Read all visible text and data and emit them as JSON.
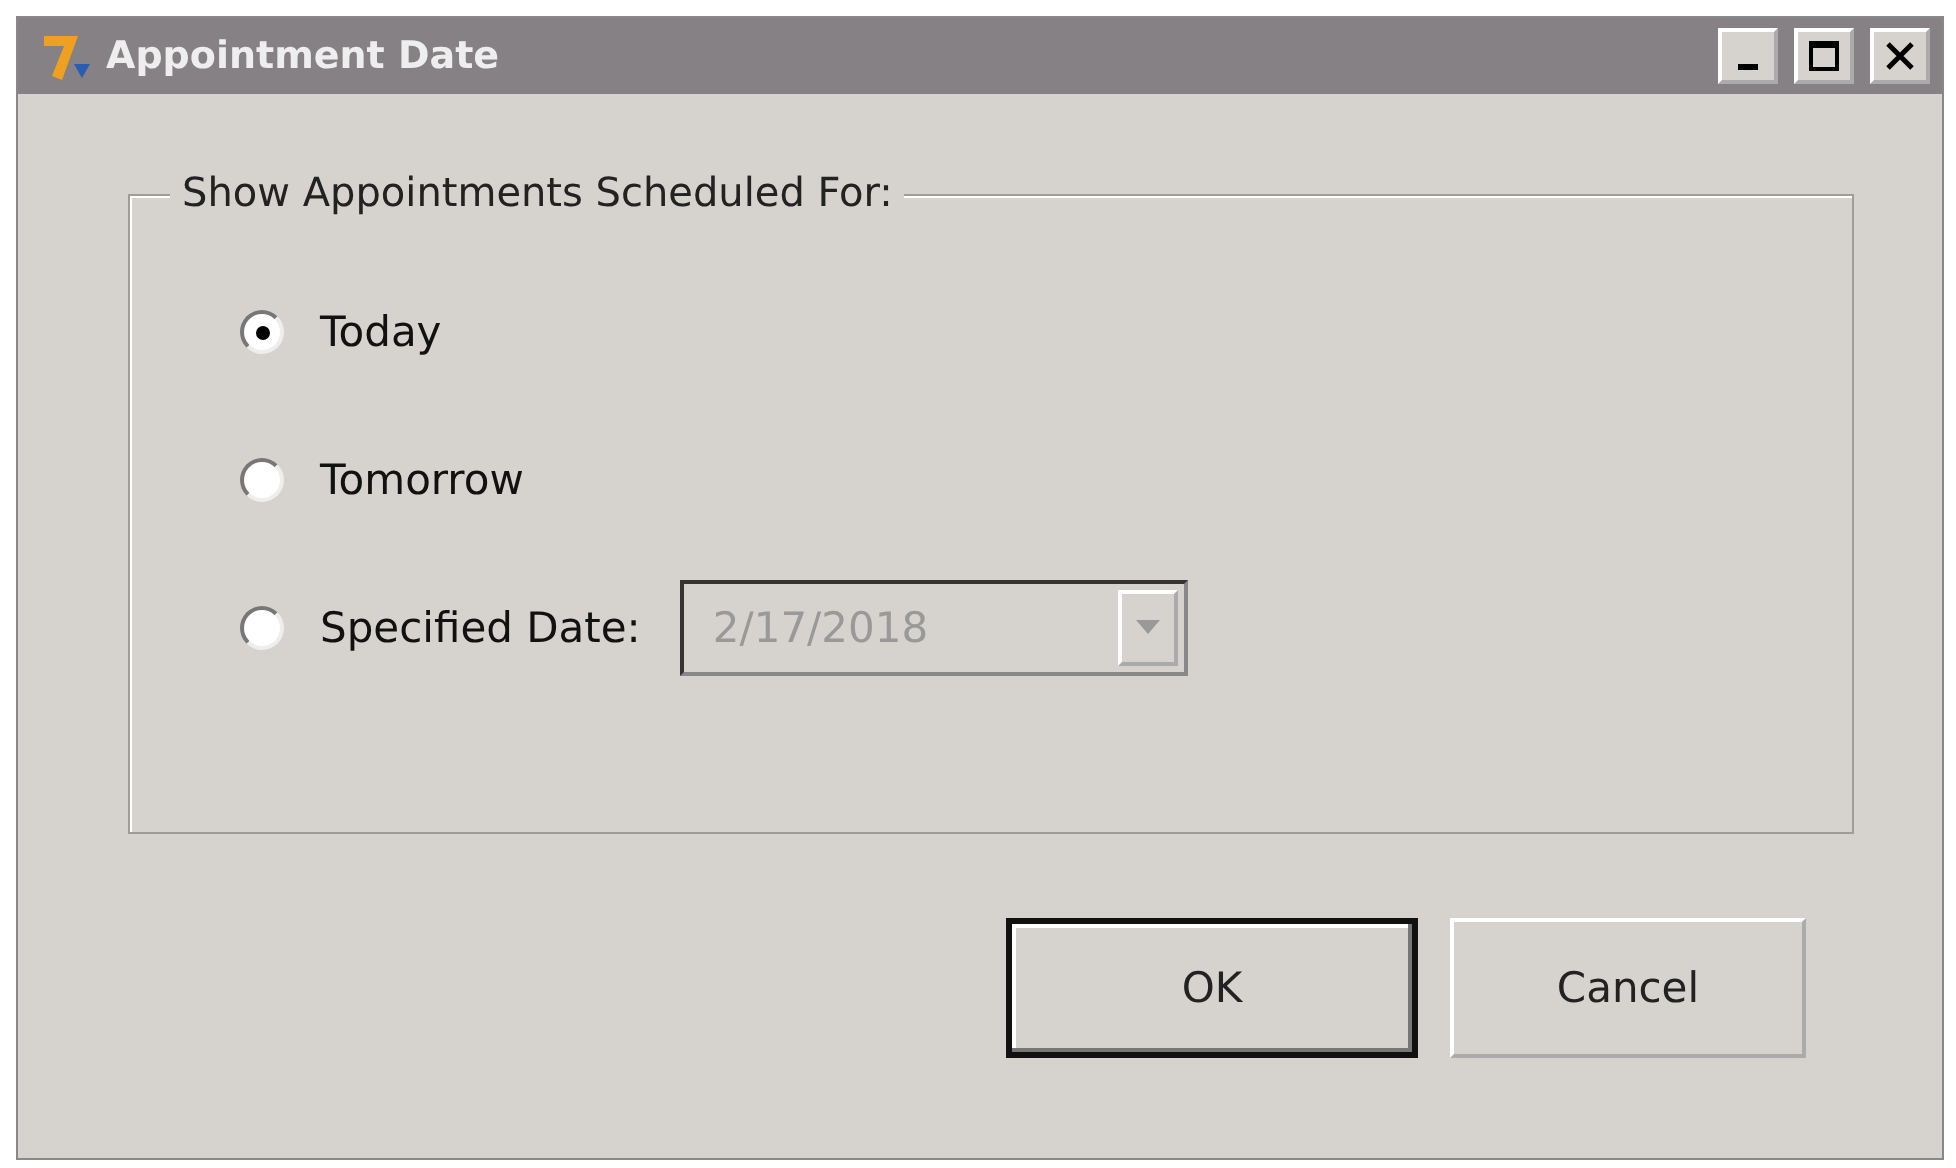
{
  "window": {
    "title": "Appointment Date"
  },
  "group": {
    "legend": "Show Appointments Scheduled For:"
  },
  "options": [
    {
      "label": "Today",
      "selected": true,
      "kind": "plain"
    },
    {
      "label": "Tomorrow",
      "selected": false,
      "kind": "plain"
    },
    {
      "label": "Specified Date:",
      "selected": false,
      "kind": "date"
    }
  ],
  "date_field": {
    "value": "2/17/2018",
    "disabled": true
  },
  "buttons": [
    {
      "label": "OK",
      "default": true
    },
    {
      "label": "Cancel",
      "default": false
    }
  ]
}
